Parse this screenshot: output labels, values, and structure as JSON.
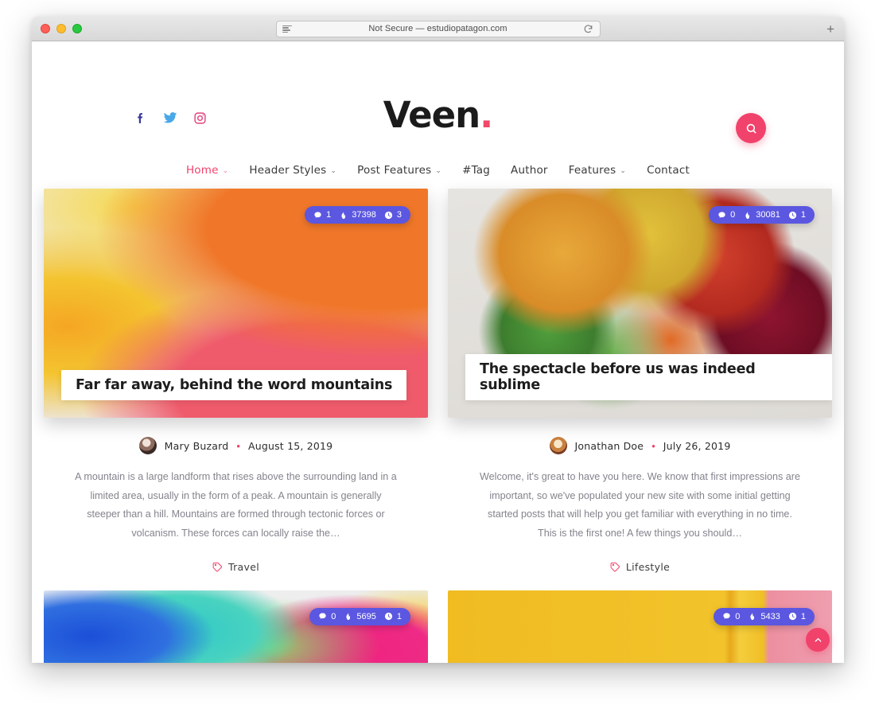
{
  "browser": {
    "url_status": "Not Secure — estudiopatagon.com",
    "reader_icon": "reader-view-icon",
    "reload_icon": "reload-icon",
    "newtab_label": "+",
    "traffic_lights": [
      "close",
      "minimize",
      "zoom"
    ]
  },
  "header": {
    "brand_name": "Veen",
    "brand_dot": ".",
    "social": [
      {
        "name": "facebook",
        "label": "f",
        "color": "#3b3b98"
      },
      {
        "name": "twitter",
        "label": "",
        "color": "#4aa8e8"
      },
      {
        "name": "instagram",
        "label": "",
        "color": "#e1417a"
      }
    ],
    "search_icon": "search-icon",
    "accent_color": "#f1426b"
  },
  "nav": {
    "items": [
      {
        "label": "Home",
        "caret": "⌄",
        "active": true
      },
      {
        "label": "Header Styles",
        "caret": "⌄",
        "active": false
      },
      {
        "label": "Post Features",
        "caret": "⌄",
        "active": false
      },
      {
        "label": "#Tag",
        "caret": "",
        "active": false
      },
      {
        "label": "Author",
        "caret": "",
        "active": false
      },
      {
        "label": "Features",
        "caret": "⌄",
        "active": false
      },
      {
        "label": "Contact",
        "caret": "",
        "active": false
      }
    ]
  },
  "posts": [
    {
      "title": "Far far away, behind the word mountains",
      "author": "Mary Buzard",
      "separator": "•",
      "date": "August 15, 2019",
      "excerpt": "A mountain is a large landform that rises above the surrounding land in a limited area, usually in the form of a peak. A mountain is generally steeper than a hill. Mountains are formed through tectonic forces or volcanism. These forces can locally raise the…",
      "category": "Travel",
      "stats": {
        "comments": "1",
        "views": "37398",
        "read_time": "3"
      }
    },
    {
      "title": "The spectacle before us was indeed sublime",
      "author": "Jonathan Doe",
      "separator": "•",
      "date": "July 26, 2019",
      "excerpt": "Welcome, it's great to have you here. We know that first impressions are important, so we've populated your new site with some initial getting started posts that will help you get familiar with everything in no time. This is the first one! A few things you should…",
      "category": "Lifestyle",
      "stats": {
        "comments": "0",
        "views": "30081",
        "read_time": "1"
      }
    },
    {
      "title": "",
      "author": "",
      "separator": "",
      "date": "",
      "excerpt": "",
      "category": "",
      "stats": {
        "comments": "0",
        "views": "5695",
        "read_time": "1"
      }
    },
    {
      "title": "",
      "author": "",
      "separator": "",
      "date": "",
      "excerpt": "",
      "category": "",
      "stats": {
        "comments": "0",
        "views": "5433",
        "read_time": "1"
      }
    }
  ],
  "scroll_top": {
    "icon": "chevron-up-icon"
  }
}
